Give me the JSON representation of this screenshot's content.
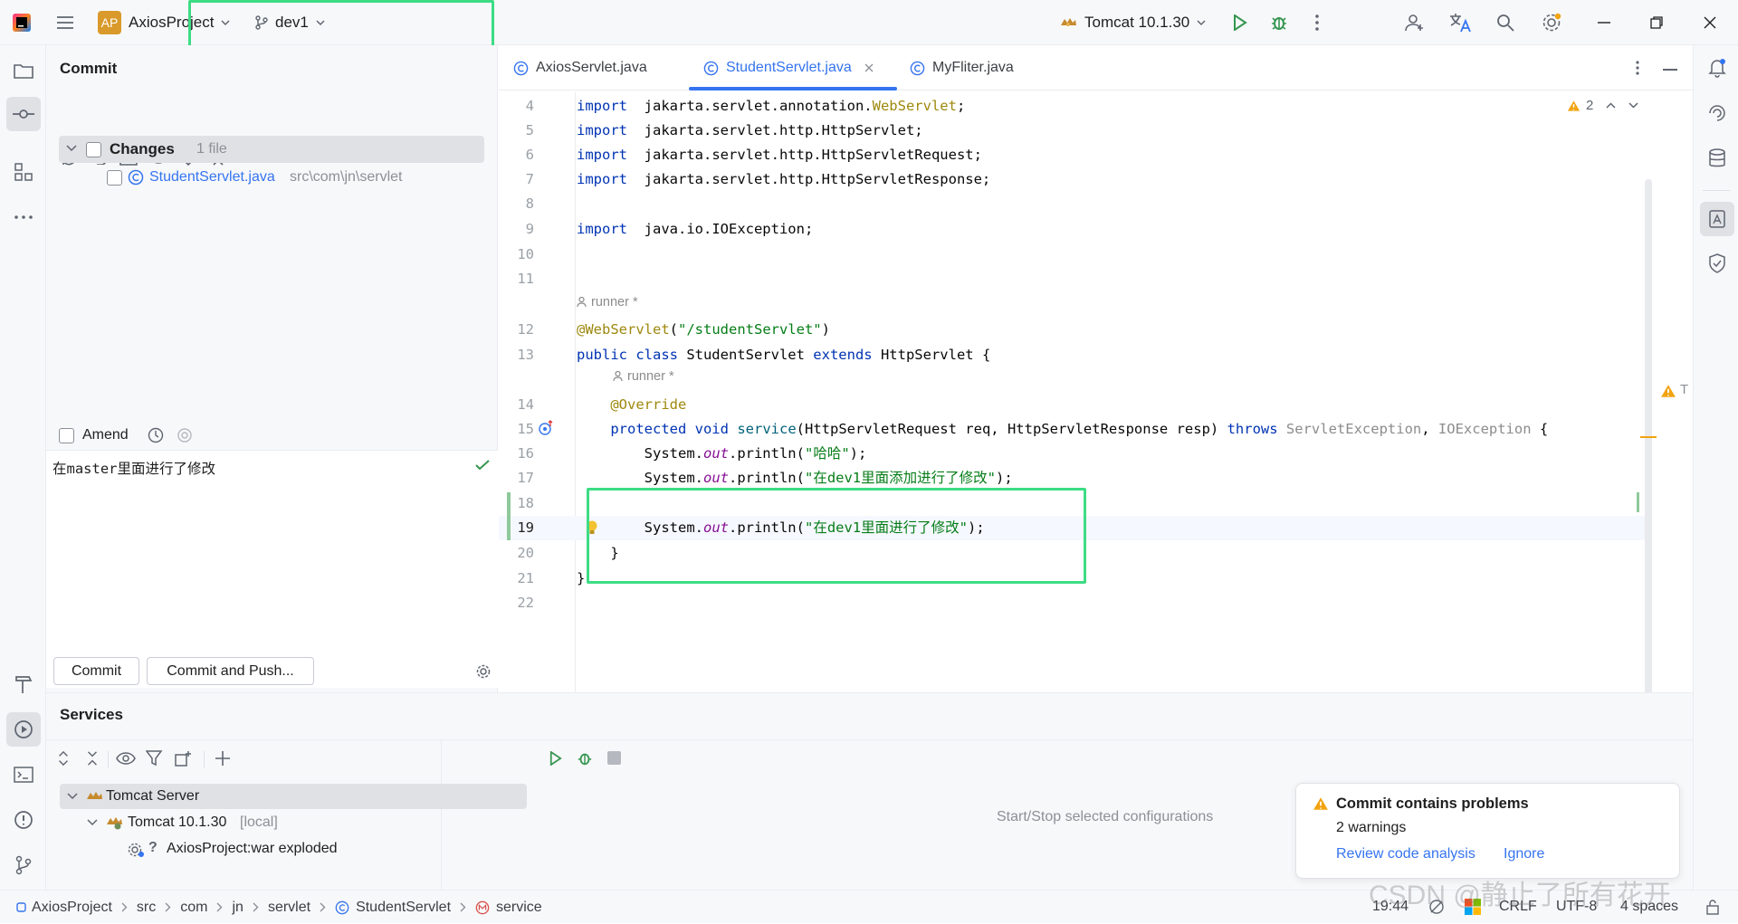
{
  "titlebar": {
    "project_avatar": "AP",
    "project_name": "AxiosProject",
    "branch": "dev1",
    "run_config": "Tomcat 10.1.30"
  },
  "tabs": [
    {
      "label": "AxiosServlet.java",
      "active": false
    },
    {
      "label": "StudentServlet.java",
      "active": true
    },
    {
      "label": "MyFliter.java",
      "active": false
    }
  ],
  "commit": {
    "title": "Commit",
    "changes_label": "Changes",
    "changes_count": "1 file",
    "file_name": "StudentServlet.java",
    "file_path": "src\\com\\jn\\servlet",
    "amend_label": "Amend",
    "message": "在master里面进行了修改",
    "commit_button": "Commit",
    "commit_push_button": "Commit and Push..."
  },
  "editor": {
    "warning_count": "2",
    "lines": [
      {
        "n": "4",
        "parts": [
          [
            "kw",
            "import"
          ],
          [
            "",
            "  jakarta.servlet.annotation."
          ],
          [
            "an",
            "WebServlet"
          ],
          [
            "",
            ";"
          ]
        ]
      },
      {
        "n": "5",
        "parts": [
          [
            "kw",
            "import"
          ],
          [
            "",
            "  jakarta.servlet.http.HttpServlet;"
          ]
        ]
      },
      {
        "n": "6",
        "parts": [
          [
            "kw",
            "import"
          ],
          [
            "",
            "  jakarta.servlet.http.HttpServletRequest;"
          ]
        ]
      },
      {
        "n": "7",
        "parts": [
          [
            "kw",
            "import"
          ],
          [
            "",
            "  jakarta.servlet.http.HttpServletResponse;"
          ]
        ]
      },
      {
        "n": "8",
        "parts": []
      },
      {
        "n": "9",
        "parts": [
          [
            "kw",
            "import"
          ],
          [
            "",
            "  java.io.IOException;"
          ]
        ]
      },
      {
        "n": "10",
        "parts": []
      },
      {
        "n": "11",
        "parts": []
      },
      {
        "n": "12",
        "parts": [
          [
            "an",
            "@WebServlet"
          ],
          [
            "",
            "("
          ],
          [
            "str",
            "\"/studentServlet\""
          ],
          [
            "",
            ")"
          ]
        ]
      },
      {
        "n": "13",
        "parts": [
          [
            "kw",
            "public class"
          ],
          [
            "",
            " StudentServlet "
          ],
          [
            "kw",
            "extends"
          ],
          [
            "",
            " HttpServlet {"
          ]
        ]
      },
      {
        "n": "14",
        "parts": [
          [
            "",
            "    "
          ],
          [
            "an",
            "@Override"
          ]
        ]
      },
      {
        "n": "15",
        "parts": [
          [
            "",
            "    "
          ],
          [
            "kw",
            "protected void"
          ],
          [
            "",
            " "
          ],
          [
            "fn",
            "service"
          ],
          [
            "",
            "(HttpServletRequest req, HttpServletResponse resp) "
          ],
          [
            "kw",
            "throws"
          ],
          [
            "",
            " "
          ],
          [
            "gray",
            "ServletException"
          ],
          [
            "",
            ", "
          ],
          [
            "gray",
            "IOException"
          ],
          [
            "",
            " {"
          ]
        ]
      },
      {
        "n": "16",
        "parts": [
          [
            "",
            "        System."
          ],
          [
            "it",
            "out"
          ],
          [
            "",
            ".println("
          ],
          [
            "str",
            "\"哈哈\""
          ],
          [
            "",
            ");"
          ]
        ]
      },
      {
        "n": "17",
        "parts": [
          [
            "",
            "        System."
          ],
          [
            "it",
            "out"
          ],
          [
            "",
            ".println("
          ],
          [
            "str",
            "\"在dev1里面添加进行了修改\""
          ],
          [
            "",
            ");"
          ]
        ]
      },
      {
        "n": "18",
        "parts": []
      },
      {
        "n": "19",
        "parts": [
          [
            "",
            "        System."
          ],
          [
            "it",
            "out"
          ],
          [
            "",
            ".println("
          ],
          [
            "str",
            "\"在dev1里面进行了修改\""
          ],
          [
            "",
            ");"
          ]
        ]
      },
      {
        "n": "20",
        "parts": [
          [
            "",
            "    }"
          ]
        ]
      },
      {
        "n": "21",
        "parts": [
          [
            "",
            "}"
          ]
        ]
      },
      {
        "n": "22",
        "parts": []
      }
    ],
    "author_hint": "runner *",
    "method_hint": "runner *"
  },
  "services": {
    "title": "Services",
    "tree": [
      {
        "label": "Tomcat Server",
        "extra": ""
      },
      {
        "label": "Tomcat 10.1.30",
        "extra": "[local]"
      },
      {
        "label": "AxiosProject:war exploded",
        "extra": "?"
      }
    ],
    "empty_text": "Start/Stop selected configurations"
  },
  "notification": {
    "title": "Commit contains problems",
    "body": "2 warnings",
    "action1": "Review code analysis",
    "action2": "Ignore"
  },
  "statusbar": {
    "breadcrumbs": [
      "AxiosProject",
      "src",
      "com",
      "jn",
      "servlet",
      "StudentServlet",
      "service"
    ],
    "time": "19:44",
    "line_sep": "CRLF",
    "encoding": "UTF-8",
    "indent": "4 spaces"
  },
  "watermark": "CSDN @静止了所有花开",
  "colors": {
    "accent": "#3574f0",
    "highlight_box": "#3ddc84",
    "warning": "#f2a30f"
  }
}
